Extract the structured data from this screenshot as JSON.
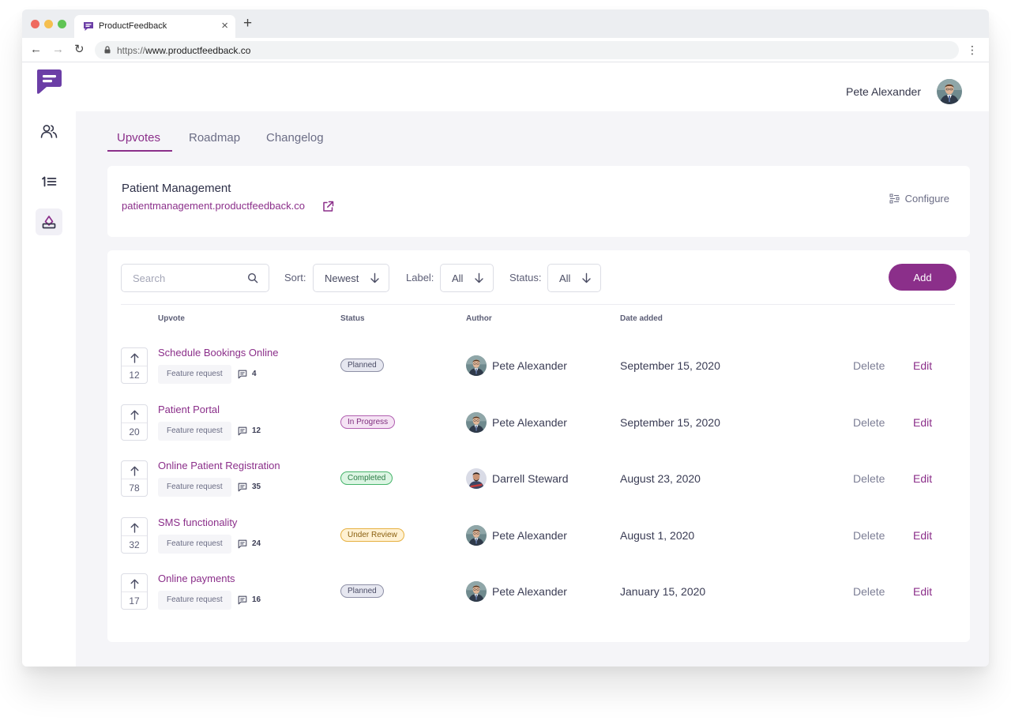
{
  "browser": {
    "tab_title": "ProductFeedback",
    "new_tab": "+",
    "close_tab": "×",
    "url_scheme": "https://",
    "url_host": "www.productfeedback.co"
  },
  "topbar": {
    "user_name": "Pete Alexander"
  },
  "tabs": [
    "Upvotes",
    "Roadmap",
    "Changelog"
  ],
  "project": {
    "name": "Patient Management",
    "link": "patientmanagement.productfeedback.co",
    "configure_label": "Configure"
  },
  "filters": {
    "search_placeholder": "Search",
    "sort_label": "Sort:",
    "sort_value": "Newest",
    "label_label": "Label:",
    "label_value": "All",
    "status_label": "Status:",
    "status_value": "All",
    "add_label": "Add"
  },
  "table": {
    "headers": [
      "Upvote",
      "Status",
      "Author",
      "Date added"
    ],
    "delete_label": "Delete",
    "edit_label": "Edit",
    "rows": [
      {
        "votes": "12",
        "title": "Schedule Bookings Online",
        "label": "Feature request",
        "comments": "4",
        "status": "Planned",
        "author": "Pete Alexander",
        "date": "September 15, 2020"
      },
      {
        "votes": "20",
        "title": "Patient Portal",
        "label": "Feature request",
        "comments": "12",
        "status": "In Progress",
        "author": "Pete Alexander",
        "date": "September 15, 2020"
      },
      {
        "votes": "78",
        "title": "Online Patient Registration",
        "label": "Feature request",
        "comments": "35",
        "status": "Completed",
        "author": "Darrell Steward",
        "date": "August 23, 2020"
      },
      {
        "votes": "32",
        "title": "SMS functionality",
        "label": "Feature request",
        "comments": "24",
        "status": "Under Review",
        "author": "Pete Alexander",
        "date": "August 1, 2020"
      },
      {
        "votes": "17",
        "title": "Online payments",
        "label": "Feature request",
        "comments": "16",
        "status": "Planned",
        "author": "Pete Alexander",
        "date": "January 15, 2020"
      }
    ]
  },
  "colors": {
    "brand": "#8b2f8a",
    "logo": "#6b3ea6",
    "planned": "#8e90a6",
    "in_progress": "#b15fb0",
    "completed": "#45b36a",
    "under_review": "#e6b040"
  },
  "icons": [
    "logo-icon",
    "users-icon",
    "numbered-list-icon",
    "upvote-icon",
    "external-link-icon",
    "configure-icon",
    "search-icon",
    "arrow-down-icon",
    "arrow-up-icon",
    "comment-icon",
    "lock-icon"
  ]
}
